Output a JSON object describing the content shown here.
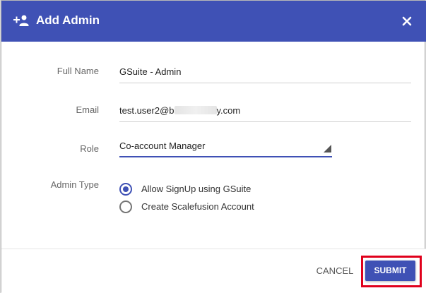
{
  "dialog": {
    "title": "Add Admin",
    "header_icon": "add-person-icon",
    "close_icon": "close-icon",
    "colors": {
      "header": "#3f51b5",
      "accent": "#3f51b5",
      "highlight": "#e0001b"
    }
  },
  "form": {
    "full_name": {
      "label": "Full Name",
      "value": "GSuite - Admin"
    },
    "email": {
      "label": "Email",
      "value_start": "test.user2@b",
      "value_end": "y.com"
    },
    "role": {
      "label": "Role",
      "value": "Co-account Manager"
    },
    "admin_type": {
      "label": "Admin Type",
      "options": [
        {
          "label": "Allow SignUp using GSuite",
          "checked": true
        },
        {
          "label": "Create Scalefusion Account",
          "checked": false
        }
      ]
    }
  },
  "footer": {
    "cancel_label": "CANCEL",
    "submit_label": "SUBMIT"
  }
}
